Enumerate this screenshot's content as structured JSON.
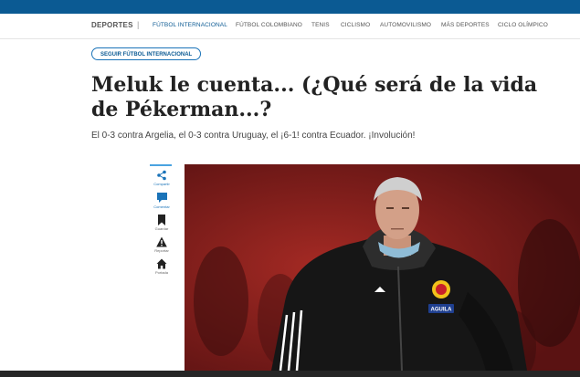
{
  "section": "DEPORTES",
  "separator": "|",
  "nav": [
    {
      "label": "FÚTBOL INTERNACIONAL",
      "active": true
    },
    {
      "label": "FÚTBOL COLOMBIANO"
    },
    {
      "label": "TENIS"
    },
    {
      "label": "CICLISMO"
    },
    {
      "label": "AUTOMOVILISMO"
    },
    {
      "label": "MÁS DEPORTES"
    },
    {
      "label": "CICLO OLÍMPICO"
    }
  ],
  "follow_button": "SEGUIR FÚTBOL INTERNACIONAL",
  "headline": "Meluk le cuenta... (¿Qué será de la vida de Pékerman...?",
  "subheadline": "El 0-3 contra Argelia, el 0-3 contra Uruguay, el ¡6-1! contra Ecuador. ¡Involución!",
  "share_toolbar": {
    "share": "Compartir",
    "comment": "Comentar",
    "save": "Guardar",
    "report": "Reportar",
    "home": "Portada"
  },
  "photo_crest_text": "AGUILA",
  "colors": {
    "brand_blue": "#0b5a93",
    "link_blue": "#1a73b8",
    "photo_background": "#7a1c1c",
    "footer": "#262626"
  }
}
